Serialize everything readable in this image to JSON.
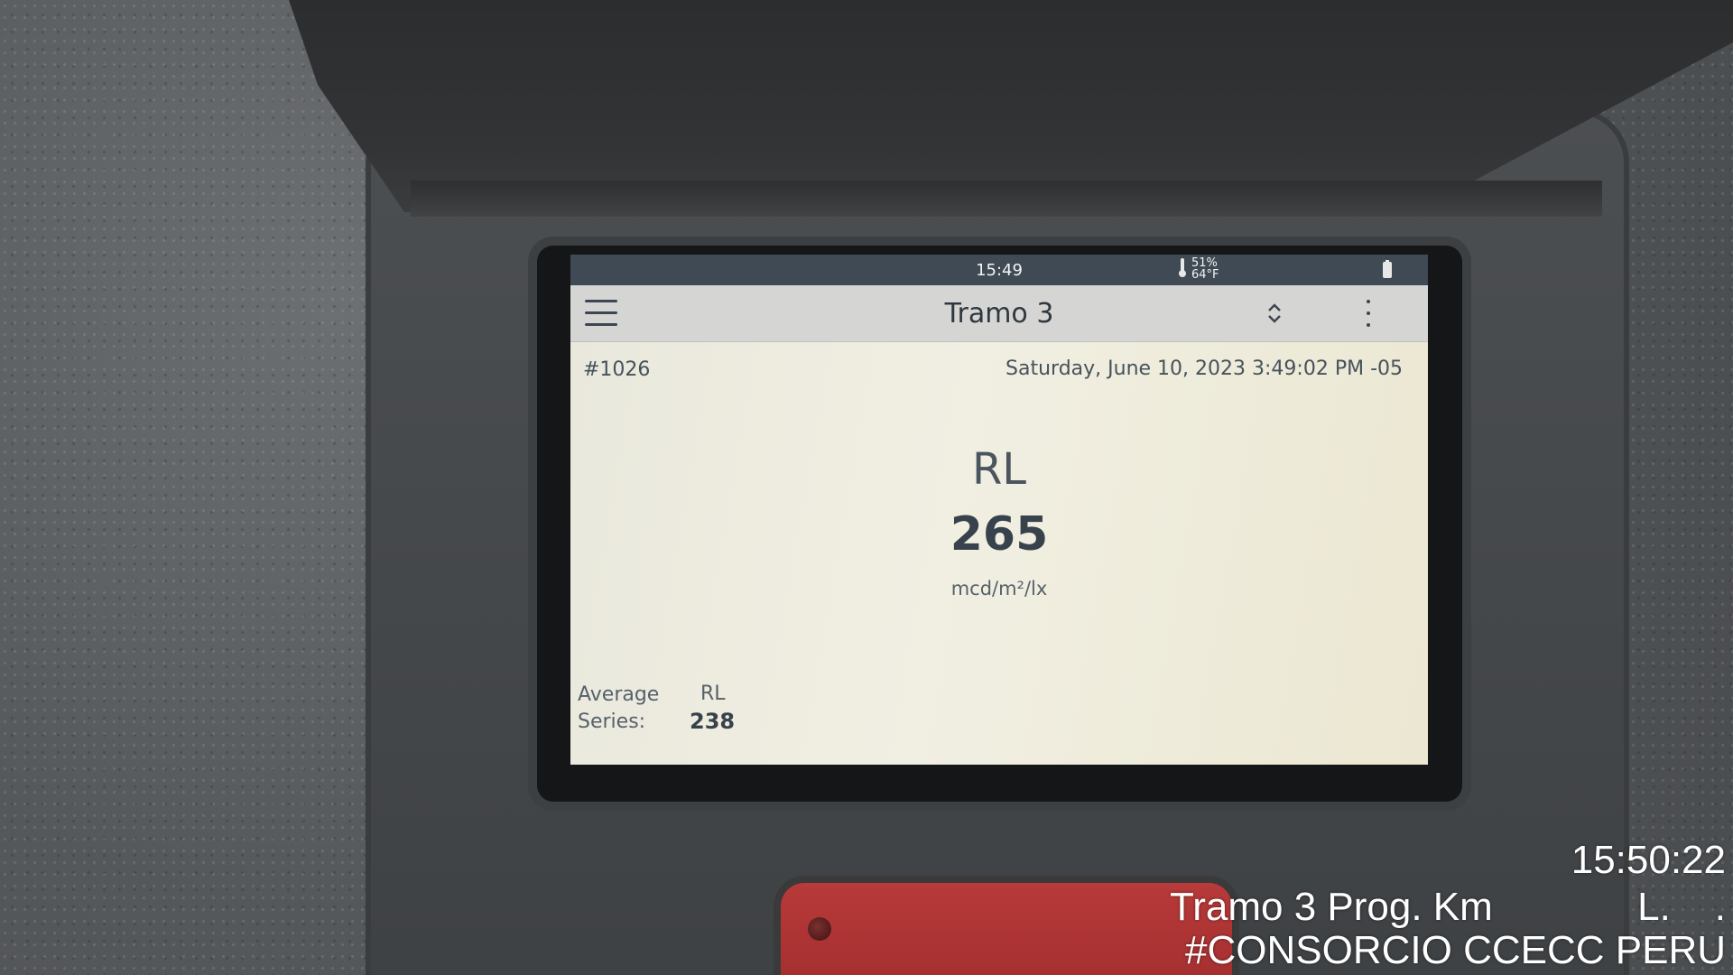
{
  "status_bar": {
    "time": "15:49",
    "humidity": "51%",
    "temperature": "64°F"
  },
  "app_bar": {
    "title": "Tramo 3"
  },
  "record": {
    "id": "#1026",
    "datetime": "Saturday, June 10, 2023 3:49:02 PM -05"
  },
  "measurement": {
    "name": "RL",
    "value": "265",
    "unit": "mcd/m²/lx"
  },
  "average": {
    "label_line1": "Average",
    "label_line2": "Series:",
    "metric": "RL",
    "value": "238"
  },
  "photo_overlay": {
    "time": "15:50:22",
    "location_line": "Tramo 3 Prog. Km",
    "location_suffix": "L.    .",
    "tag_line": "#CONSORCIO CCECC PERU"
  },
  "colors": {
    "status_bar_bg": "#3f4a54",
    "app_bar_bg": "#d5d6d3",
    "screen_bg": "#efede0",
    "text_dark": "#37424c",
    "red_button": "#b83a3a"
  }
}
